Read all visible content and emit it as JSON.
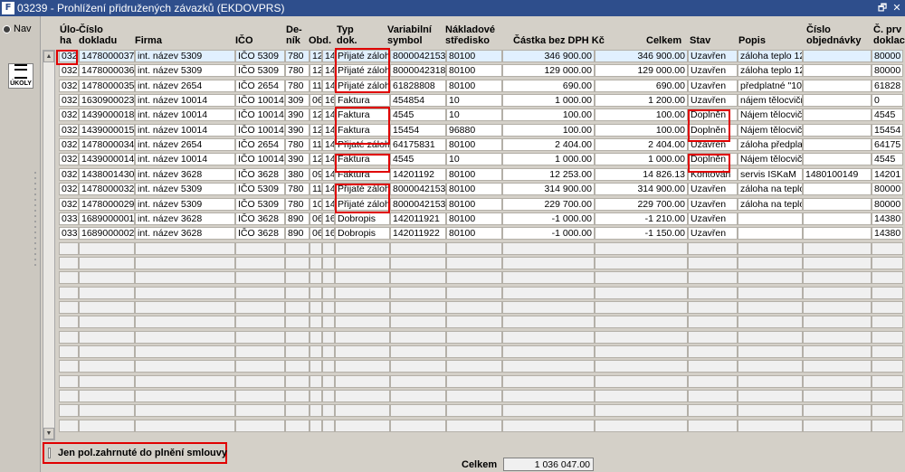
{
  "window": {
    "title": "03239 - Prohlížení přidružených závazků (EKDOVPRS)",
    "app_icon": "F",
    "restore_glyph": "🗗",
    "close_glyph": "✕"
  },
  "sidebar": {
    "nav_label": "Nav",
    "ukoly_label": "ÚKOLY"
  },
  "columns": [
    {
      "key": "uloha",
      "l1": "Úlo-",
      "l2": "ha"
    },
    {
      "key": "doklad",
      "l1": "Číslo",
      "l2": "dokladu"
    },
    {
      "key": "firma",
      "l1": "",
      "l2": "Firma"
    },
    {
      "key": "ico",
      "l1": "",
      "l2": "IČO"
    },
    {
      "key": "denik",
      "l1": "De-",
      "l2": "ník"
    },
    {
      "key": "obd",
      "l1": "",
      "l2": "Obd."
    },
    {
      "key": "x",
      "l1": "",
      "l2": ""
    },
    {
      "key": "typ",
      "l1": "Typ",
      "l2": "dok."
    },
    {
      "key": "vs",
      "l1": "Variabilní",
      "l2": "symbol"
    },
    {
      "key": "ns",
      "l1": "Nákladové",
      "l2": "středisko"
    },
    {
      "key": "bezdph",
      "l1": "",
      "l2": "Částka bez DPH Kč"
    },
    {
      "key": "celkem",
      "l1": "",
      "l2": "Celkem"
    },
    {
      "key": "stav",
      "l1": "",
      "l2": "Stav"
    },
    {
      "key": "popis",
      "l1": "",
      "l2": "Popis"
    },
    {
      "key": "objednavka",
      "l1": "Číslo",
      "l2": "objednávky"
    },
    {
      "key": "prv",
      "l1": "Č. prv",
      "l2": "doklac"
    }
  ],
  "rows": [
    {
      "uloha": "032",
      "doklad": "1478000037",
      "firma": "int. název 5309",
      "ico": "IČO 5309",
      "denik": "780",
      "obd": "12",
      "x": "14",
      "typ": "Přijaté záloh",
      "vs": "8000042153",
      "ns": "80100",
      "bezdph": "346 900.00",
      "celkem": "346 900.00",
      "stav": "Uzavřen",
      "popis": "záloha teplo 12.",
      "objednavka": "",
      "prv": "80000"
    },
    {
      "uloha": "032",
      "doklad": "1478000036",
      "firma": "int. název 5309",
      "ico": "IČO 5309",
      "denik": "780",
      "obd": "12",
      "x": "14",
      "typ": "Přijaté záloh",
      "vs": "8000042318",
      "ns": "80100",
      "bezdph": "129 000.00",
      "celkem": "129 000.00",
      "stav": "Uzavřen",
      "popis": "záloha teplo 12.",
      "objednavka": "",
      "prv": "80000"
    },
    {
      "uloha": "032",
      "doklad": "1478000035",
      "firma": "int. název 2654",
      "ico": "IČO 2654",
      "denik": "780",
      "obd": "11",
      "x": "14",
      "typ": "Přijaté záloh",
      "vs": "61828808",
      "ns": "80100",
      "bezdph": "690.00",
      "celkem": "690.00",
      "stav": "Uzavřen",
      "popis": "předplatné \"10(",
      "objednavka": "",
      "prv": "61828"
    },
    {
      "uloha": "032",
      "doklad": "1630900023",
      "firma": "int. název 10014",
      "ico": "IČO 10014",
      "denik": "309",
      "obd": "06",
      "x": "16",
      "typ": "Faktura",
      "vs": "454854",
      "ns": "10",
      "bezdph": "1 000.00",
      "celkem": "1 200.00",
      "stav": "Uzavřen",
      "popis": "nájem tělocvičn",
      "objednavka": "",
      "prv": "0"
    },
    {
      "uloha": "032",
      "doklad": "1439000018",
      "firma": "int. název 10014",
      "ico": "IČO 10014",
      "denik": "390",
      "obd": "12",
      "x": "14",
      "typ": "Faktura",
      "vs": "4545",
      "ns": "10",
      "bezdph": "100.00",
      "celkem": "100.00",
      "stav": "Doplněn",
      "popis": "Nájem tělocvičn",
      "objednavka": "",
      "prv": "4545"
    },
    {
      "uloha": "032",
      "doklad": "1439000015",
      "firma": "int. název 10014",
      "ico": "IČO 10014",
      "denik": "390",
      "obd": "12",
      "x": "14",
      "typ": "Faktura",
      "vs": "15454",
      "ns": "96880",
      "bezdph": "100.00",
      "celkem": "100.00",
      "stav": "Doplněn",
      "popis": "Nájem tělocvičn",
      "objednavka": "",
      "prv": "15454"
    },
    {
      "uloha": "032",
      "doklad": "1478000034",
      "firma": "int. název 2654",
      "ico": "IČO 2654",
      "denik": "780",
      "obd": "11",
      "x": "14",
      "typ": "Přijaté záloh",
      "vs": "64175831",
      "ns": "80100",
      "bezdph": "2 404.00",
      "celkem": "2 404.00",
      "stav": "Uzavřen",
      "popis": "záloha předplat",
      "objednavka": "",
      "prv": "64175"
    },
    {
      "uloha": "032",
      "doklad": "1439000014",
      "firma": "int. název 10014",
      "ico": "IČO 10014",
      "denik": "390",
      "obd": "12",
      "x": "14",
      "typ": "Faktura",
      "vs": "4545",
      "ns": "10",
      "bezdph": "1 000.00",
      "celkem": "1 000.00",
      "stav": "Doplněn",
      "popis": "Nájem tělocvičn",
      "objednavka": "",
      "prv": "4545"
    },
    {
      "uloha": "032",
      "doklad": "1438001430",
      "firma": "int. název 3628",
      "ico": "IČO 3628",
      "denik": "380",
      "obd": "09",
      "x": "14",
      "typ": "Faktura",
      "vs": "14201192",
      "ns": "80100",
      "bezdph": "12 253.00",
      "celkem": "14 826.13",
      "stav": "Kontován",
      "popis": "servis ISKaM",
      "objednavka": "1480100149",
      "prv": "14201"
    },
    {
      "uloha": "032",
      "doklad": "1478000032",
      "firma": "int. název 5309",
      "ico": "IČO 5309",
      "denik": "780",
      "obd": "11",
      "x": "14",
      "typ": "Přijaté záloh",
      "vs": "8000042153",
      "ns": "80100",
      "bezdph": "314 900.00",
      "celkem": "314 900.00",
      "stav": "Uzavřen",
      "popis": "záloha na teplo",
      "objednavka": "",
      "prv": "80000"
    },
    {
      "uloha": "032",
      "doklad": "1478000029",
      "firma": "int. název 5309",
      "ico": "IČO 5309",
      "denik": "780",
      "obd": "10",
      "x": "14",
      "typ": "Přijaté záloh",
      "vs": "8000042153",
      "ns": "80100",
      "bezdph": "229 700.00",
      "celkem": "229 700.00",
      "stav": "Uzavřen",
      "popis": "záloha na teplo",
      "objednavka": "",
      "prv": "80000"
    },
    {
      "uloha": "033",
      "doklad": "1689000001",
      "firma": "int. název 3628",
      "ico": "IČO 3628",
      "denik": "890",
      "obd": "06",
      "x": "16",
      "typ": "Dobropis",
      "vs": "142011921",
      "ns": "80100",
      "bezdph": "-1 000.00",
      "celkem": "-1 210.00",
      "stav": "Uzavřen",
      "popis": "",
      "objednavka": "",
      "prv": "14380"
    },
    {
      "uloha": "033",
      "doklad": "1689000002",
      "firma": "int. název 3628",
      "ico": "IČO 3628",
      "denik": "890",
      "obd": "06",
      "x": "16",
      "typ": "Dobropis",
      "vs": "142011922",
      "ns": "80100",
      "bezdph": "-1 000.00",
      "celkem": "-1 150.00",
      "stav": "Uzavřen",
      "popis": "",
      "objednavka": "",
      "prv": "14380"
    }
  ],
  "footer": {
    "checkbox_label": "Jen pol.zahrnuté do plnění smlouvy",
    "total_label": "Celkem",
    "total_value": "1 036 047.00"
  },
  "colors": {
    "titlebar": "#2e4e8c",
    "selected_row": "#e1f0ff",
    "highlight": "#e00000"
  }
}
